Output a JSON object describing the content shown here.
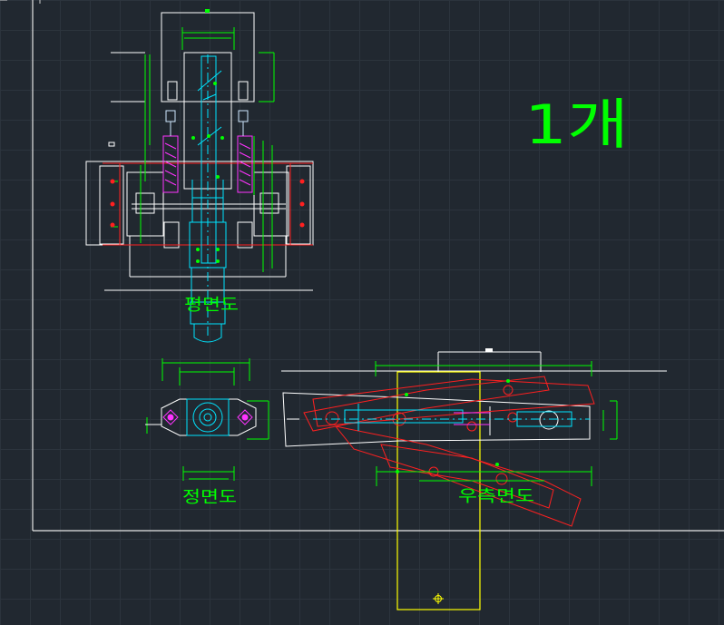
{
  "drawing": {
    "quantity_note": "1개",
    "label_plan": "평면도",
    "label_front": "정면도",
    "label_side": "우측면도"
  },
  "colors": {
    "background": "#212830",
    "border": "#ffffff",
    "dimension": "#00ff00",
    "part": "#00ffff",
    "hidden": "#ff0000",
    "accent": "#ff00ff",
    "block": "#ffff00",
    "note": "#00ff00"
  },
  "icons": {
    "ucs": "crosshair-icon"
  }
}
